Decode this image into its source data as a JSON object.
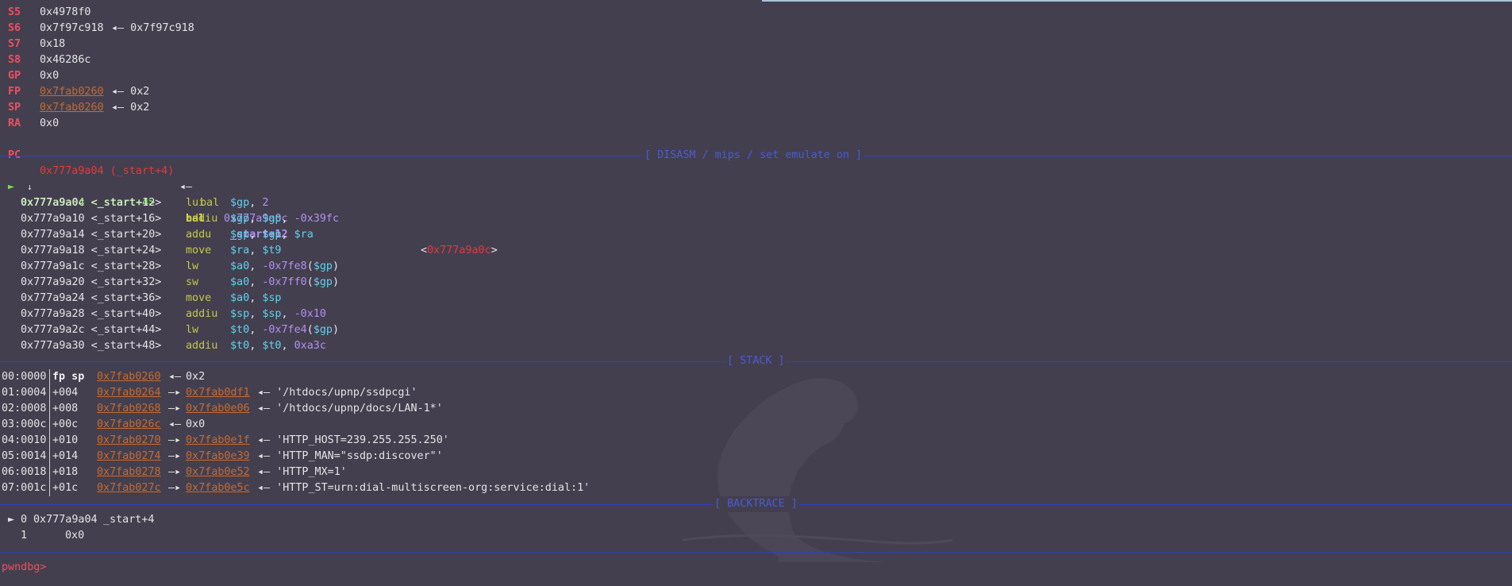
{
  "registers": [
    {
      "name": "S5",
      "value": "0x4978f0",
      "link": false,
      "deref": ""
    },
    {
      "name": "S6",
      "value": "0x7f97c918",
      "link": false,
      "deref": "◂— 0x7f97c918"
    },
    {
      "name": "S7",
      "value": "0x18",
      "link": false,
      "deref": ""
    },
    {
      "name": "S8",
      "value": "0x46286c",
      "link": false,
      "deref": ""
    },
    {
      "name": "GP",
      "value": "0x0",
      "link": false,
      "deref": ""
    },
    {
      "name": "FP",
      "value": "0x7fab0260",
      "link": true,
      "deref": "◂— 0x2"
    },
    {
      "name": "SP",
      "value": "0x7fab0260",
      "link": true,
      "deref": "◂— 0x2"
    },
    {
      "name": "RA",
      "value": "0x0",
      "link": false,
      "deref": ""
    }
  ],
  "pc": {
    "name": "PC",
    "value": "0x777a9a04 (_start+4)",
    "arrow": "◂—",
    "instr": "bal",
    "target": "0x777a9a0c"
  },
  "sections": {
    "disasm": "[ DISASM / mips / set emulate on ]",
    "stack": "[ STACK ]",
    "backtrace": "[ BACKTRACE ]"
  },
  "disasm_current": {
    "marker": "►",
    "addr": "0x777a9a04 <_start+4>",
    "mnem": "bal",
    "op": "_start+12",
    "target_open": "<",
    "target": "0x777a9a0c",
    "target_close": ">"
  },
  "branch_arrow": "↓",
  "disasm": [
    {
      "addr": "0x777a9a0c <_start+12>",
      "mnem": "lui",
      "ops": [
        [
          "cyan",
          "$gp"
        ],
        [
          "white",
          ", "
        ],
        [
          "purple",
          "2"
        ]
      ]
    },
    {
      "addr": "0x777a9a10 <_start+16>",
      "mnem": "addiu",
      "ops": [
        [
          "cyan",
          "$gp"
        ],
        [
          "white",
          ", "
        ],
        [
          "cyan",
          "$gp"
        ],
        [
          "white",
          ", "
        ],
        [
          "purple",
          "-0x39fc"
        ]
      ]
    },
    {
      "addr": "0x777a9a14 <_start+20>",
      "mnem": "addu",
      "ops": [
        [
          "cyan",
          "$gp"
        ],
        [
          "white",
          ", "
        ],
        [
          "cyan",
          "$gp"
        ],
        [
          "white",
          ", "
        ],
        [
          "cyan",
          "$ra"
        ]
      ]
    },
    {
      "addr": "0x777a9a18 <_start+24>",
      "mnem": "move",
      "ops": [
        [
          "cyan",
          "$ra"
        ],
        [
          "white",
          ", "
        ],
        [
          "cyan",
          "$t9"
        ]
      ]
    },
    {
      "addr": "0x777a9a1c <_start+28>",
      "mnem": "lw",
      "ops": [
        [
          "cyan",
          "$a0"
        ],
        [
          "white",
          ", "
        ],
        [
          "purple",
          "-0x7fe8"
        ],
        [
          "white",
          "("
        ],
        [
          "cyan",
          "$gp"
        ],
        [
          "white",
          ")"
        ]
      ]
    },
    {
      "addr": "0x777a9a20 <_start+32>",
      "mnem": "sw",
      "ops": [
        [
          "cyan",
          "$a0"
        ],
        [
          "white",
          ", "
        ],
        [
          "purple",
          "-0x7ff0"
        ],
        [
          "white",
          "("
        ],
        [
          "cyan",
          "$gp"
        ],
        [
          "white",
          ")"
        ]
      ]
    },
    {
      "addr": "0x777a9a24 <_start+36>",
      "mnem": "move",
      "ops": [
        [
          "cyan",
          "$a0"
        ],
        [
          "white",
          ", "
        ],
        [
          "cyan",
          "$sp"
        ]
      ]
    },
    {
      "addr": "0x777a9a28 <_start+40>",
      "mnem": "addiu",
      "ops": [
        [
          "cyan",
          "$sp"
        ],
        [
          "white",
          ", "
        ],
        [
          "cyan",
          "$sp"
        ],
        [
          "white",
          ", "
        ],
        [
          "purple",
          "-0x10"
        ]
      ]
    },
    {
      "addr": "0x777a9a2c <_start+44>",
      "mnem": "lw",
      "ops": [
        [
          "cyan",
          "$t0"
        ],
        [
          "white",
          ", "
        ],
        [
          "purple",
          "-0x7fe4"
        ],
        [
          "white",
          "("
        ],
        [
          "cyan",
          "$gp"
        ],
        [
          "white",
          ")"
        ]
      ]
    },
    {
      "addr": "0x777a9a30 <_start+48>",
      "mnem": "addiu",
      "ops": [
        [
          "cyan",
          "$t0"
        ],
        [
          "white",
          ", "
        ],
        [
          "cyan",
          "$t0"
        ],
        [
          "white",
          ", "
        ],
        [
          "purple",
          "0xa3c"
        ]
      ]
    }
  ],
  "stack": [
    {
      "idx": "00:0000",
      "off": "fp sp",
      "addr": "0x7fab0260",
      "arrow": "◂—",
      "ptr": "",
      "val": "0x2"
    },
    {
      "idx": "01:0004",
      "off": "+004",
      "addr": "0x7fab0264",
      "arrow": "—▸",
      "ptr": "0x7fab0df1",
      "val": "◂— '/htdocs/upnp/ssdpcgi'"
    },
    {
      "idx": "02:0008",
      "off": "+008",
      "addr": "0x7fab0268",
      "arrow": "—▸",
      "ptr": "0x7fab0e06",
      "val": "◂— '/htdocs/upnp/docs/LAN-1*'"
    },
    {
      "idx": "03:000c",
      "off": "+00c",
      "addr": "0x7fab026c",
      "arrow": "◂—",
      "ptr": "",
      "val": "0x0"
    },
    {
      "idx": "04:0010",
      "off": "+010",
      "addr": "0x7fab0270",
      "arrow": "—▸",
      "ptr": "0x7fab0e1f",
      "val": "◂— 'HTTP_HOST=239.255.255.250'"
    },
    {
      "idx": "05:0014",
      "off": "+014",
      "addr": "0x7fab0274",
      "arrow": "—▸",
      "ptr": "0x7fab0e39",
      "val": "◂— 'HTTP_MAN=\"ssdp:discover\"'"
    },
    {
      "idx": "06:0018",
      "off": "+018",
      "addr": "0x7fab0278",
      "arrow": "—▸",
      "ptr": "0x7fab0e52",
      "val": "◂— 'HTTP_MX=1'"
    },
    {
      "idx": "07:001c",
      "off": "+01c",
      "addr": "0x7fab027c",
      "arrow": "—▸",
      "ptr": "0x7fab0e5c",
      "val": "◂— 'HTTP_ST=urn:dial-multiscreen-org:service:dial:1'"
    }
  ],
  "backtrace": [
    {
      "marker": "►",
      "num": "0",
      "addr": "0x777a9a04",
      "sym": "_start+4"
    },
    {
      "marker": "",
      "num": "1",
      "addr": "0x0",
      "sym": ""
    }
  ],
  "prompt": "pwndbg>"
}
